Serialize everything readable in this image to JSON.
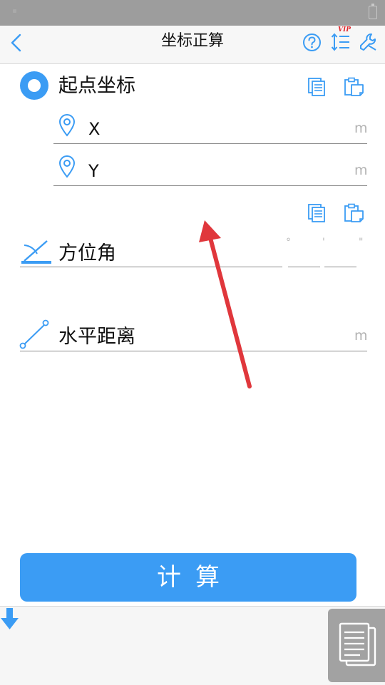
{
  "header": {
    "title": "坐标正算",
    "vip_badge": "VIP",
    "icons": [
      "back-icon",
      "help-icon",
      "sort-icon",
      "settings-wrench-icon"
    ]
  },
  "start_point": {
    "label": "起点坐标",
    "fields": [
      {
        "name": "X",
        "unit": "m"
      },
      {
        "name": "Y",
        "unit": "m"
      }
    ]
  },
  "azimuth": {
    "label": "方位角",
    "degree_mark": "°",
    "minute_mark": "'",
    "second_mark": "\""
  },
  "distance": {
    "label": "水平距离",
    "unit": "m"
  },
  "actions": {
    "calculate_label": "计算"
  },
  "colors": {
    "accent": "#3b9cf4",
    "status_bar": "#9d9d9d",
    "arrow": "#e0373c",
    "unit_text": "#b3b3b3"
  }
}
